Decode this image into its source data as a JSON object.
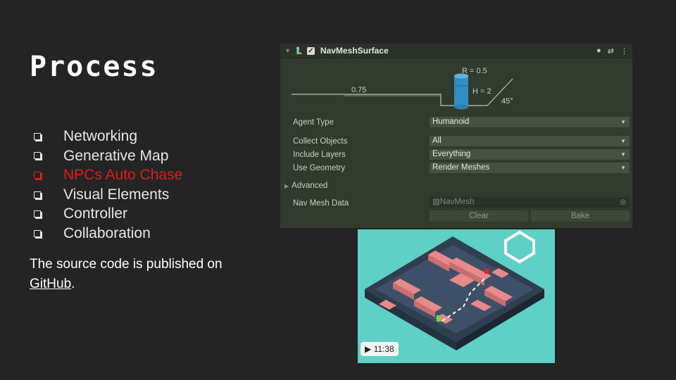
{
  "slide": {
    "title": "Process",
    "bullets": [
      {
        "text": "Networking",
        "highlighted": false
      },
      {
        "text": "Generative Map",
        "highlighted": false
      },
      {
        "text": "NPCs Auto Chase",
        "highlighted": true
      },
      {
        "text": "Visual Elements",
        "highlighted": false
      },
      {
        "text": "Controller",
        "highlighted": false
      },
      {
        "text": "Collaboration",
        "highlighted": false
      }
    ],
    "source_text": "The source code is published on",
    "source_link": "GitHub",
    "source_suffix": ".",
    "highlight_color": "#e21b1b"
  },
  "inspector": {
    "component_title": "NavMeshSurface",
    "enabled": true,
    "diagram": {
      "radius_label": "R = 0.5",
      "height_label": "H = 2",
      "step_label": "0.75",
      "slope_label": "45°"
    },
    "rows": [
      {
        "label": "Agent Type",
        "value": "Humanoid"
      },
      {
        "label": "Collect Objects",
        "value": "All"
      },
      {
        "label": "Include Layers",
        "value": "Everything"
      },
      {
        "label": "Use Geometry",
        "value": "Render Meshes"
      }
    ],
    "advanced_label": "Advanced",
    "nav_mesh_data_label": "Nav Mesh Data",
    "nav_mesh_data_value": "NavMesh",
    "clear_button": "Clear",
    "bake_button": "Bake"
  },
  "video": {
    "timestamp": "11:38"
  }
}
